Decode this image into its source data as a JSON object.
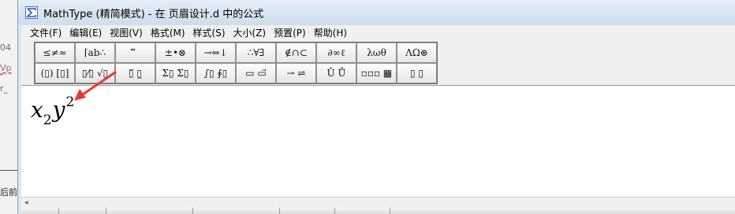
{
  "window": {
    "title": "MathType (精简模式) - 在 页眉设计.d 中的公式",
    "accent_color": "#3b6fd6"
  },
  "background_doc": {
    "fragments": [
      "04",
      "Vp",
      "r_",
      "后前"
    ]
  },
  "menu": {
    "items": [
      "文件(F)",
      "编辑(E)",
      "视图(V)",
      "格式(M)",
      "样式(S)",
      "大小(Z)",
      "预置(P)",
      "帮助(H)"
    ]
  },
  "palette": {
    "row1": [
      "≤≠≈",
      "⌈ab∴",
      "⃗⃡⃖",
      "±•⊗",
      "→⇔↓",
      "∴∀∃",
      "∉∩⊂",
      "∂∞ℓ",
      "λωθ",
      "ΛΩ⊛"
    ],
    "row2": [
      "(▯) [▯]",
      "▯⁄▯ √▯",
      "▯̅ ▯̲",
      "Σ▯ Σ▯",
      "∫▯ ∮▯",
      "▭ ▭⃗",
      "→ ⇌",
      "Ū Ů",
      "▫▫▫ ▦",
      "▯ ▯"
    ]
  },
  "editor": {
    "equation": {
      "x": "x",
      "sub": "2",
      "y": "y",
      "sup": "2"
    }
  },
  "scroll": {
    "left_arrow": "◂"
  },
  "annotation": {
    "arrow_color": "#e8392c"
  }
}
